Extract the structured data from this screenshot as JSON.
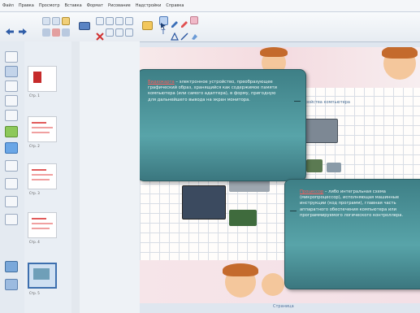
{
  "menu": [
    "Файл",
    "Правка",
    "Просмотр",
    "Вставка",
    "Формат",
    "Рисование",
    "Надстройки",
    "Справка"
  ],
  "callout1": {
    "keyword": "Видеокарта",
    "text": " – электронное устройство, преобразующее графический образ, хранящийся как содержимое памяти компьютера (или самого адаптера), в форму, пригодную для дальнейшего вывода на экран монитора."
  },
  "callout2": {
    "keyword": "Процессор",
    "text": " – либо интегральная схема (микропроцессор), исполняющая машинные инструкции (код программ), главная часть аппаратного обеспечения компьютера или программируемого логического контроллера."
  },
  "slide_heading": "Устройства компьютера",
  "thumb_labels": [
    "Стр. 1",
    "Стр. 2",
    "Стр. 3",
    "Стр. 4",
    "Стр. 5"
  ],
  "footer_text": "Страница",
  "colors": {
    "callout": "#4f969b",
    "keyword": "#ff5a5a",
    "accent": "#3d6fae"
  }
}
